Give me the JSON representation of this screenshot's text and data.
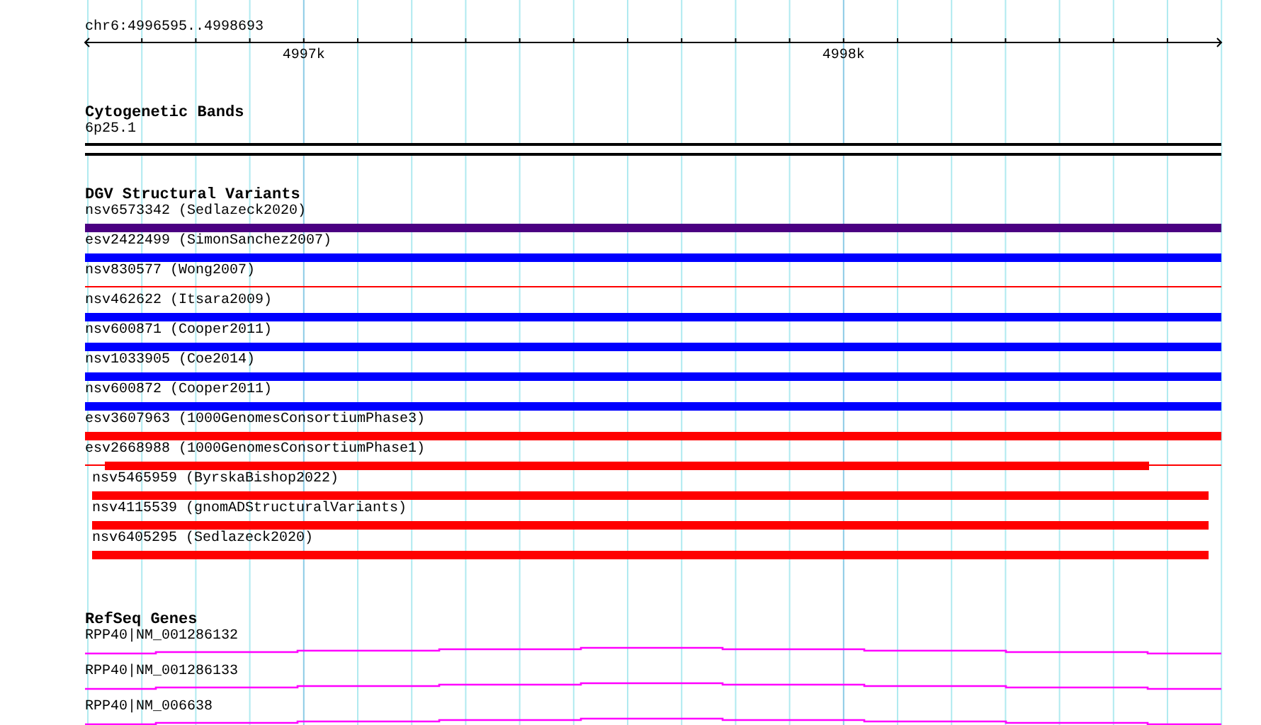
{
  "ruler": {
    "location": "chr6:4996595..4998693",
    "ticks": [
      {
        "label": "4997k"
      },
      {
        "label": "4998k"
      }
    ]
  },
  "tracks": [
    {
      "kind": "bands",
      "title": "Cytogenetic Bands",
      "features": [
        {
          "label": "6p25.1"
        }
      ]
    },
    {
      "kind": "variants",
      "title": "DGV Structural Variants",
      "features": [
        {
          "label": "nsv6573342 (Sedlazeck2020)",
          "kind": "bar",
          "color": "#4b0082"
        },
        {
          "label": "esv2422499 (SimonSanchez2007)",
          "kind": "bar",
          "color": "#0000ff"
        },
        {
          "label": "nsv830577 (Wong2007)",
          "kind": "line",
          "color": "#ff0000"
        },
        {
          "label": "nsv462622 (Itsara2009)",
          "kind": "bar",
          "color": "#0000ff"
        },
        {
          "label": "nsv600871 (Cooper2011)",
          "kind": "bar",
          "color": "#0000ff"
        },
        {
          "label": "nsv1033905 (Coe2014)",
          "kind": "bar",
          "color": "#0000ff"
        },
        {
          "label": "nsv600872 (Cooper2011)",
          "kind": "bar",
          "color": "#0000ff"
        },
        {
          "label": "esv3607963 (1000GenomesConsortiumPhase3)",
          "kind": "bar",
          "color": "#ff0000"
        },
        {
          "label": "esv2668988 (1000GenomesConsortiumPhase1)",
          "kind": "inset",
          "color": "#ff0000"
        },
        {
          "label": "nsv5465959 (ByrskaBishop2022)",
          "kind": "padded",
          "color": "#ff0000"
        },
        {
          "label": "nsv4115539 (gnomADStructuralVariants)",
          "kind": "padded",
          "color": "#ff0000"
        },
        {
          "label": "nsv6405295 (Sedlazeck2020)",
          "kind": "padded",
          "color": "#ff0000"
        }
      ]
    },
    {
      "kind": "genes",
      "title": "RefSeq Genes",
      "features": [
        {
          "label": "RPP40|NM_001286132"
        },
        {
          "label": "RPP40|NM_001286133"
        },
        {
          "label": "RPP40|NM_006638"
        }
      ]
    }
  ]
}
